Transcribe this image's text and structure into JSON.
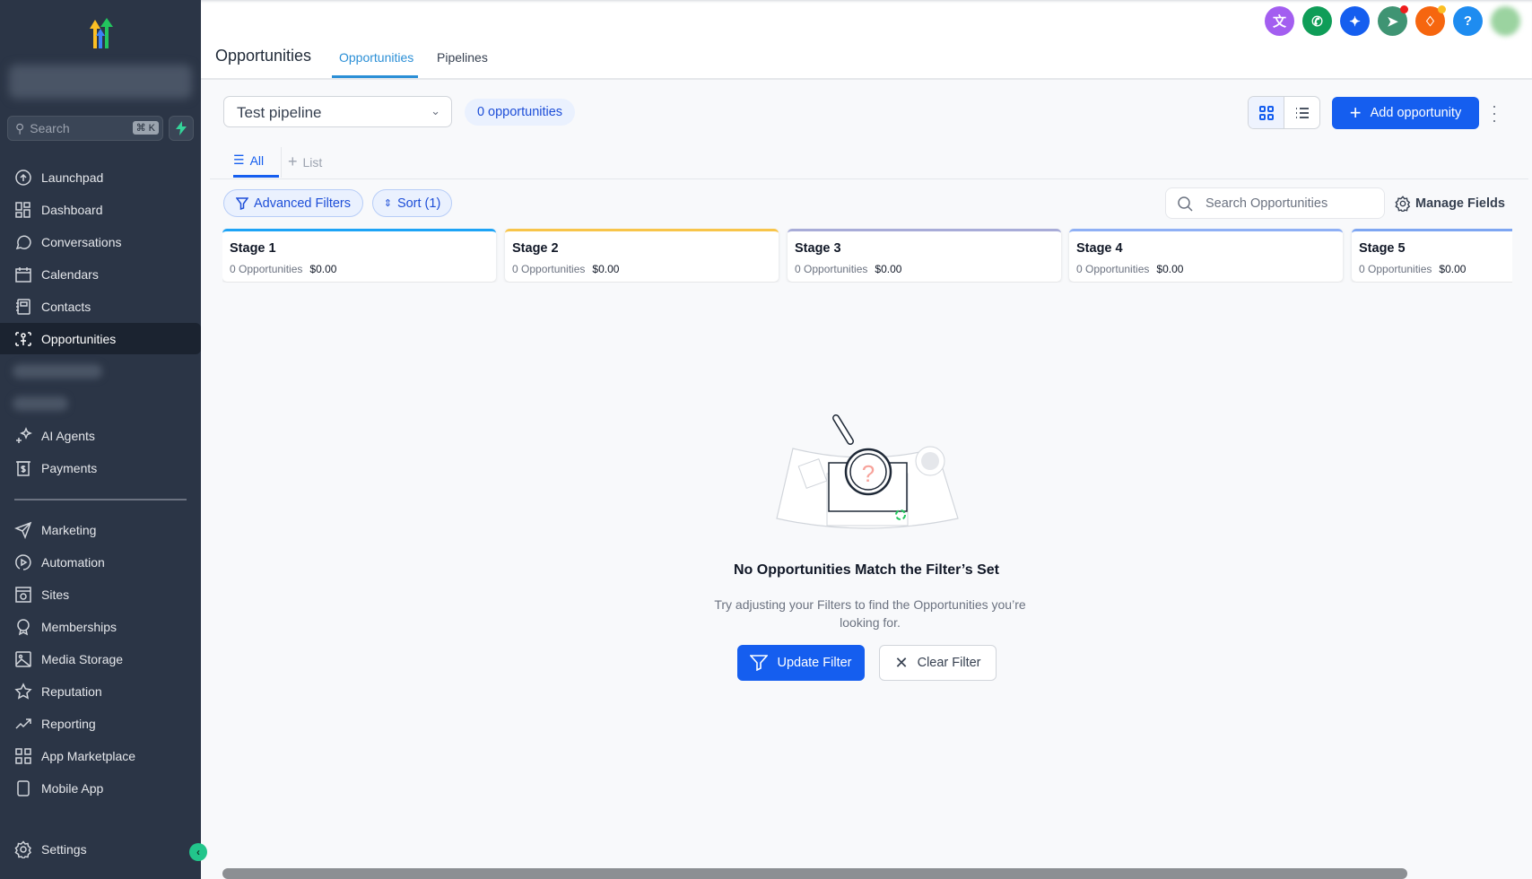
{
  "sidebar": {
    "search_placeholder": "Search",
    "search_shortcut": "⌘ K",
    "items": [
      {
        "label": "Launchpad",
        "icon": "launchpad-icon"
      },
      {
        "label": "Dashboard",
        "icon": "dashboard-icon"
      },
      {
        "label": "Conversations",
        "icon": "chat-icon"
      },
      {
        "label": "Calendars",
        "icon": "calendar-icon"
      },
      {
        "label": "Contacts",
        "icon": "contacts-icon"
      },
      {
        "label": "Opportunities",
        "icon": "opportunities-icon",
        "active": true
      },
      {
        "label": "AI Agents",
        "icon": "sparkle-icon"
      },
      {
        "label": "Payments",
        "icon": "payments-icon"
      }
    ],
    "items2": [
      {
        "label": "Marketing",
        "icon": "send-icon"
      },
      {
        "label": "Automation",
        "icon": "automation-icon"
      },
      {
        "label": "Sites",
        "icon": "sites-icon"
      },
      {
        "label": "Memberships",
        "icon": "award-icon"
      },
      {
        "label": "Media Storage",
        "icon": "image-icon"
      },
      {
        "label": "Reputation",
        "icon": "star-icon"
      },
      {
        "label": "Reporting",
        "icon": "trending-icon"
      },
      {
        "label": "App Marketplace",
        "icon": "grid-icon"
      },
      {
        "label": "Mobile App",
        "icon": "mobile-icon"
      }
    ],
    "settings_label": "Settings"
  },
  "header": {
    "title": "Opportunities",
    "tabs": [
      {
        "label": "Opportunities",
        "active": true
      },
      {
        "label": "Pipelines"
      }
    ],
    "top_icons": [
      {
        "name": "translate-icon",
        "color": "#a35ef0"
      },
      {
        "name": "phone-icon",
        "color": "#0f9d58"
      },
      {
        "name": "ai-sparkle-icon",
        "color": "#155eef"
      },
      {
        "name": "megaphone-icon",
        "color": "#3f9473"
      },
      {
        "name": "bell-icon",
        "color": "#f6660f"
      },
      {
        "name": "help-icon",
        "color": "#1e8cf0",
        "glyph": "?"
      }
    ]
  },
  "toolbar": {
    "pipeline": "Test pipeline",
    "count_badge": "0 opportunities",
    "add_label": "Add opportunity"
  },
  "views": {
    "all": "All",
    "add_list": "List"
  },
  "filters": {
    "advanced": "Advanced Filters",
    "sort": "Sort (1)",
    "search_placeholder": "Search Opportunities",
    "manage_fields": "Manage Fields"
  },
  "stages": [
    {
      "name": "Stage 1",
      "count": "0 Opportunities",
      "amount": "$0.00",
      "color": "#1ea4f6"
    },
    {
      "name": "Stage 2",
      "count": "0 Opportunities",
      "amount": "$0.00",
      "color": "#f8c54a"
    },
    {
      "name": "Stage 3",
      "count": "0 Opportunities",
      "amount": "$0.00",
      "color": "#a8acd8"
    },
    {
      "name": "Stage 4",
      "count": "0 Opportunities",
      "amount": "$0.00",
      "color": "#8fb0f5"
    },
    {
      "name": "Stage 5",
      "count": "0 Opportunities",
      "amount": "$0.00",
      "color": "#7ea6f2"
    }
  ],
  "empty_state": {
    "title": "No Opportunities Match the Filter’s Set",
    "text": "Try adjusting your Filters to find the Opportunities you’re looking for.",
    "update_label": "Update Filter",
    "clear_label": "Clear Filter"
  }
}
